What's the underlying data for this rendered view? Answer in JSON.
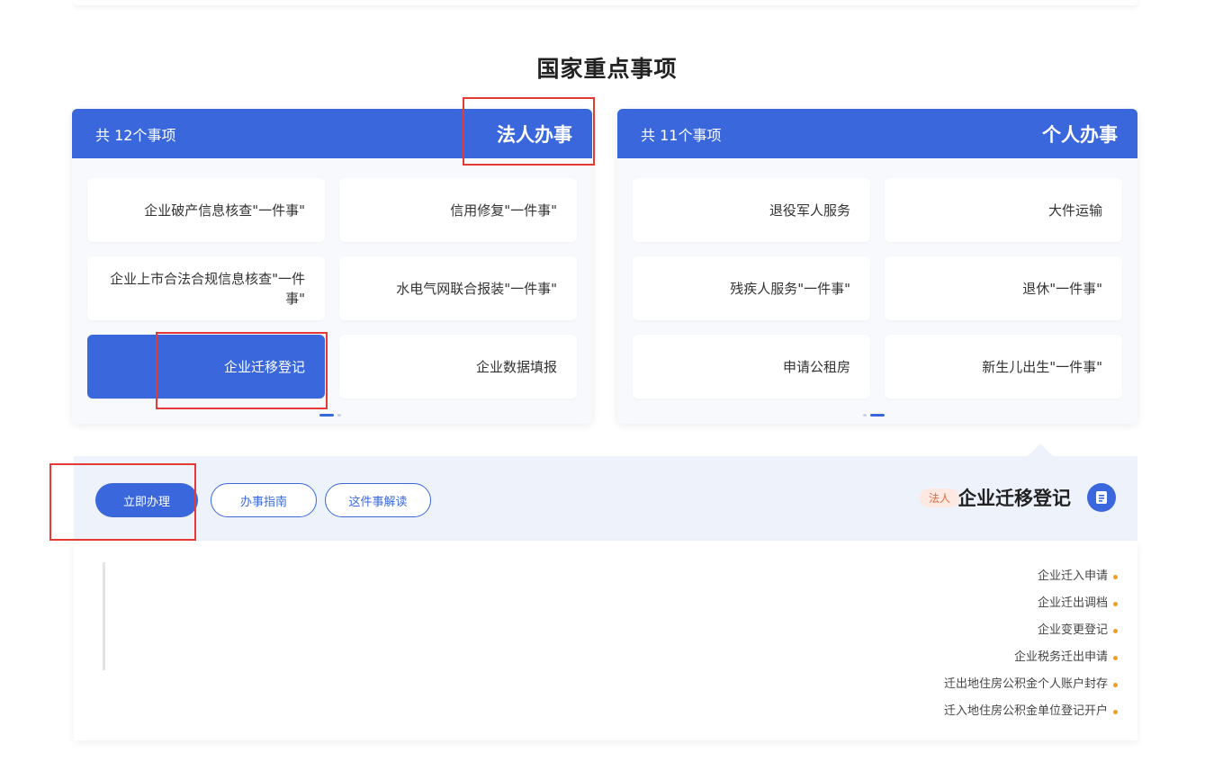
{
  "section_title": "国家重点事项",
  "panels": {
    "legal": {
      "title": "法人办事",
      "count": "共 12个事项",
      "items": [
        "企业破产信息核查\"一件事\"",
        "信用修复\"一件事\"",
        "企业上市合法合规信息核查\"一件事\"",
        "水电气网联合报装\"一件事\"",
        "企业迁移登记",
        "企业数据填报"
      ]
    },
    "personal": {
      "title": "个人办事",
      "count": "共 11个事项",
      "items": [
        "退役军人服务",
        "大件运输",
        "残疾人服务\"一件事\"",
        "退休\"一件事\"",
        "申请公租房",
        "新生儿出生\"一件事\""
      ]
    }
  },
  "detail": {
    "title": "企业迁移登记",
    "tag": "法人",
    "buttons": {
      "read": "这件事解读",
      "guide": "办事指南",
      "go": "立即办理"
    },
    "items": [
      "企业迁入申请",
      "企业迁出调档",
      "企业变更登记",
      "企业税务迁出申请",
      "迁出地住房公积金个人账户封存",
      "迁入地住房公积金单位登记开户"
    ]
  },
  "colors": {
    "primary": "#3a68dc",
    "highlight_box": "#e53935",
    "tag_text": "#e56b3b",
    "bullet": "#f0a020"
  }
}
